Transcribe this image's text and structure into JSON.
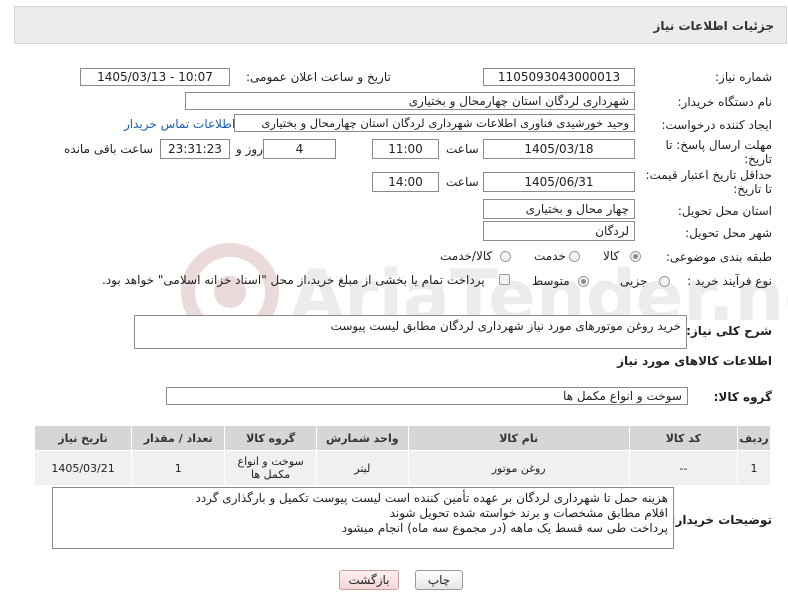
{
  "header": {
    "title": "جزئیات اطلاعات نیاز"
  },
  "fields": {
    "need_number_label": "شماره نیاز:",
    "need_number": "1105093043000013",
    "announce_label": "تاریخ و ساعت اعلان عمومی:",
    "announce_value": "1405/03/13 - 10:07",
    "buyer_org_label": "نام دستگاه خریدار:",
    "buyer_org": "شهرداری لردگان استان چهارمحال و بختیاری",
    "creator_label": "ایجاد کننده درخواست:",
    "creator": "وحید خورشیدی فناوری اطلاعات شهرداری لردگان استان چهارمحال و بختیاری",
    "contact_link": "اطلاعات تماس خریدار",
    "reply_deadline_label": "مهلت ارسال پاسخ: تا تاریخ:",
    "reply_date": "1405/03/18",
    "time_label": "ساعت",
    "reply_time": "11:00",
    "days": "4",
    "days_and_label": "روز و",
    "remaining_time": "23:31:23",
    "remaining_label": "ساعت باقی مانده",
    "price_validity_label": "حداقل تاریخ اعتبار قیمت: تا تاریخ:",
    "validity_date": "1405/06/31",
    "validity_time": "14:00",
    "province_label": "استان محل تحویل:",
    "province": "چهار محال و بختیاری",
    "city_label": "شهر محل تحویل:",
    "city": "لردگان",
    "category_label": "طبقه بندی موضوعی:",
    "category_options": [
      "کالا",
      "خدمت",
      "کالا/خدمت"
    ],
    "process_label": "نوع فرآیند خرید :",
    "process_options": [
      "جزیی",
      "متوسط"
    ],
    "payment_note": "پرداخت تمام یا بخشی از مبلغ خرید،از محل \"اسناد خزانه اسلامی\" خواهد بود.",
    "description_label": "شرح کلی نیاز:",
    "description": "خرید روغن موتورهای مورد نیاز شهرداری لردگان مطابق لیست پیوست",
    "goods_info_title": "اطلاعات کالاهای مورد نیاز",
    "goods_group_label": "گروه کالا:",
    "goods_group": "سوخت و انواع مکمل ها"
  },
  "table": {
    "headers": [
      "ردیف",
      "کد کالا",
      "نام کالا",
      "واحد شمارش",
      "گروه کالا",
      "تعداد / مقدار",
      "تاریخ نیاز"
    ],
    "rows": [
      [
        "1",
        "--",
        "روغن موتور",
        "لیتر",
        "سوخت و انواع مکمل ها",
        "1",
        "1405/03/21"
      ]
    ]
  },
  "buyer_notes": {
    "label": "توضیحات خریدار:",
    "line1": "هزینه حمل تا شهرداری لردگان بر عهده تأمین کننده است لیست پیوست تکمیل و بارگذاری گردد",
    "line2": "اقلام مطابق مشخصات و برند خواسته شده تحویل شوند",
    "line3": "پرداخت طی سه قسط یک ماهه (در مجموع سه ماه) انجام میشود"
  },
  "buttons": {
    "print": "چاپ",
    "back": "بازگشت"
  },
  "watermark": "AriaTender.net"
}
